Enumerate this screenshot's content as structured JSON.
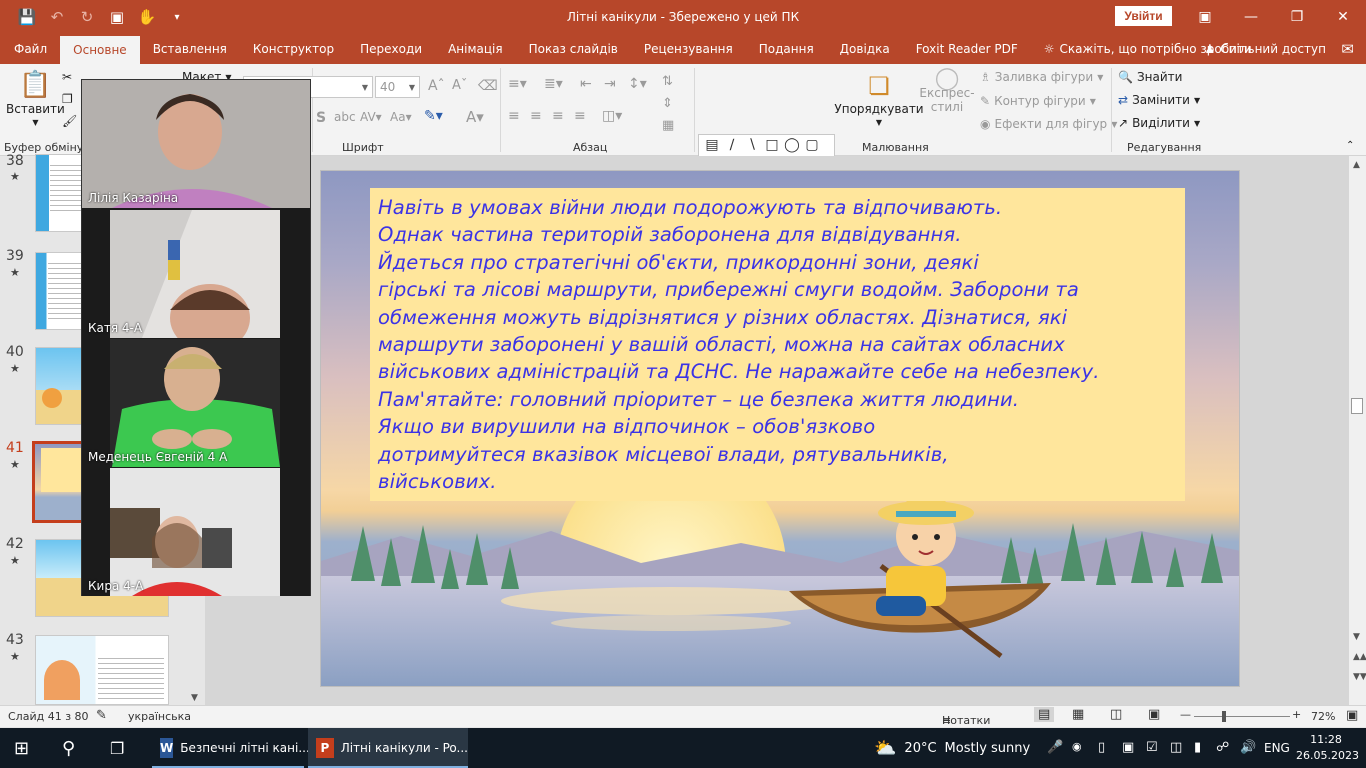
{
  "titlebar": {
    "title": "Літні канікули  -  Збережено у цей ПК",
    "signin": "Увійти"
  },
  "tabs": [
    {
      "label": "Файл"
    },
    {
      "label": "Основне",
      "active": true
    },
    {
      "label": "Вставлення"
    },
    {
      "label": "Конструктор"
    },
    {
      "label": "Переходи"
    },
    {
      "label": "Анімація"
    },
    {
      "label": "Показ слайдів"
    },
    {
      "label": "Рецензування"
    },
    {
      "label": "Подання"
    },
    {
      "label": "Довідка"
    },
    {
      "label": "Foxit Reader PDF"
    }
  ],
  "tell_me": "Скажіть, що потрібно зробити",
  "share": "Спільний доступ",
  "ribbon": {
    "paste": "Вставити",
    "layout": "Макет",
    "font_size": "40",
    "arrange": "Упорядкувати",
    "quick_styles_line1": "Експрес-",
    "quick_styles_line2": "стилі",
    "shape_fill": "Заливка фігури",
    "shape_outline": "Контур фігури",
    "shape_effects": "Ефекти для фігур",
    "find": "Знайти",
    "replace": "Замінити",
    "select": "Виділити",
    "groups": {
      "clipboard": "Буфер обміну",
      "font": "Шрифт",
      "paragraph": "Абзац",
      "drawing": "Малювання",
      "editing": "Редагування"
    }
  },
  "thumbnails": [
    {
      "num": "38",
      "star": "★"
    },
    {
      "num": "39",
      "star": "★"
    },
    {
      "num": "40",
      "star": "★"
    },
    {
      "num": "41",
      "star": "★"
    },
    {
      "num": "42",
      "star": "★"
    },
    {
      "num": "43",
      "star": "★"
    }
  ],
  "slide": {
    "lines": [
      "Навіть в умовах війни люди подорожують та відпочивають.",
      "Однак частина територій заборонена для відвідування.",
      "Йдеться про стратегічні об'єкти, прикордонні зони, деякі",
      "гірські та лісові маршрути, прибережні смуги водойм.  Заборони та",
      "обмеження можуть відрізнятися у різних областях. Дізнатися, які",
      "маршрути заборонені у вашій області, можна на сайтах обласних",
      "військових адміністрацій та ДСНС. Не наражайте себе на небезпеку.",
      "Пам'ятайте: головний пріоритет – це безпека життя людини.",
      "Якщо ви вирушили на відпочинок – обов'язково",
      "дотримуйтеся вказівок місцевої влади, рятувальників,",
      "військових."
    ]
  },
  "video": [
    {
      "name": "Лілія Казаріна"
    },
    {
      "name": "Катя  4-А"
    },
    {
      "name": "Меденець Євгеній 4 А"
    },
    {
      "name": "Кира 4-А"
    }
  ],
  "status": {
    "slide": "Слайд 41 з 80",
    "language": "українська",
    "notes": "Нотатки",
    "zoom": "72%"
  },
  "taskbar": {
    "word_app": "Безпечні літні кані...",
    "ppt_app": "Літні канікули - Po...",
    "weather_temp": "20°C",
    "weather_desc": "Mostly sunny",
    "lang": "ENG",
    "time": "11:28",
    "date": "26.05.2023"
  },
  "colors": {
    "accent": "#b7472a",
    "slide_text": "#3b33e6",
    "textbox_bg": "#ffe69c"
  }
}
